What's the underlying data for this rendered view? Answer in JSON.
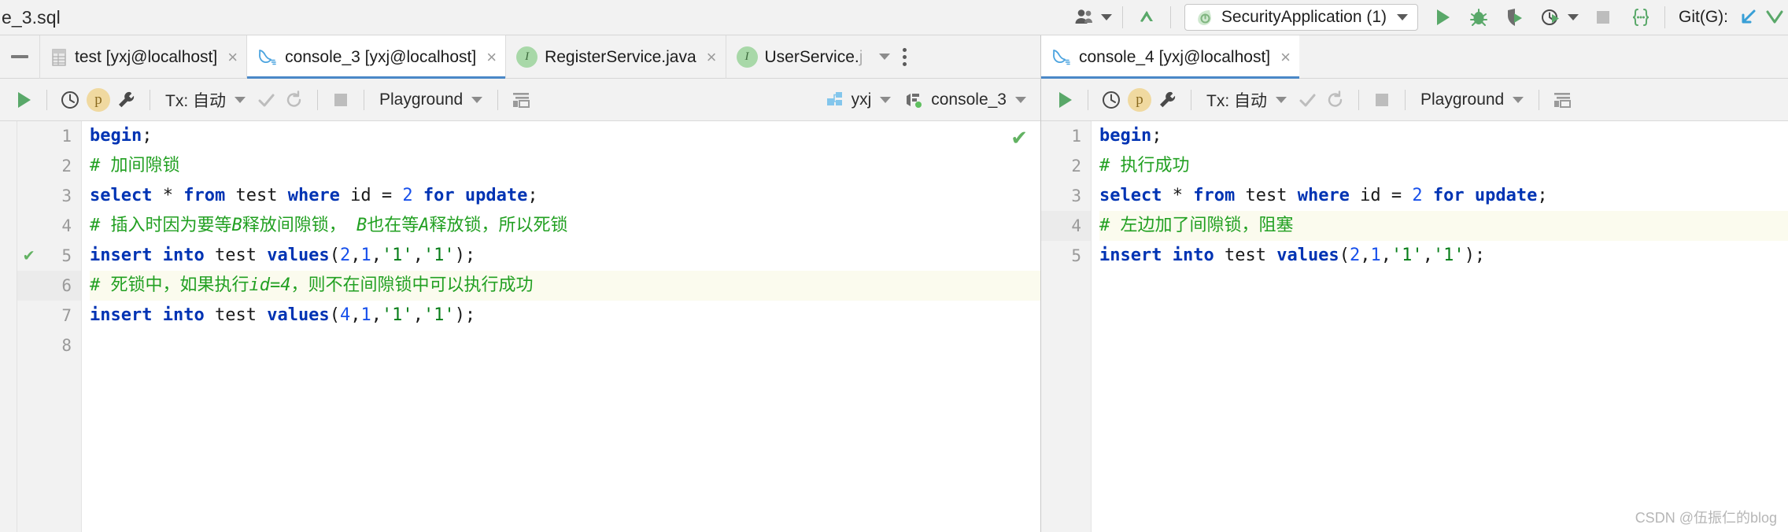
{
  "titlebar": {
    "filename": "e_3.sql",
    "user_icon": "users-icon",
    "vcs_update_icon": "vcs-update-arrow-icon",
    "run_config": {
      "icon": "spring-boot-leaf-icon",
      "label": "SecurityApplication (1)",
      "caret": "chevron-down-icon"
    },
    "actions": [
      {
        "name": "run-button",
        "icon": "play-icon"
      },
      {
        "name": "debug-button",
        "icon": "bug-icon"
      },
      {
        "name": "run-with-coverage-button",
        "icon": "coverage-shield-icon"
      },
      {
        "name": "profiler-button",
        "icon": "clock-play-icon"
      },
      {
        "name": "stop-button",
        "icon": "stop-square-icon"
      },
      {
        "name": "code-braces-button",
        "icon": "braces-icon"
      }
    ],
    "git": {
      "label": "Git(G):",
      "update_icon": "git-update-icon",
      "commit_icon": "git-commit-icon"
    }
  },
  "tabs_left": [
    {
      "name": "tab-test-db",
      "icon": "database-table-icon",
      "label": "test [yxj@localhost]",
      "selected": false,
      "close": "×"
    },
    {
      "name": "tab-console-3",
      "icon": "mysql-dolphin-icon",
      "label": "console_3 [yxj@localhost]",
      "selected": true,
      "close": "×"
    },
    {
      "name": "tab-register-service",
      "icon": "java-class-icon",
      "label": "RegisterService.java",
      "selected": false,
      "close": "×"
    },
    {
      "name": "tab-user-service",
      "icon": "java-class-icon",
      "label": "UserService.",
      "label_dim": "j",
      "selected": false,
      "close": ""
    }
  ],
  "tabs_left_overflow": {
    "chevron": "chevron-down-icon",
    "more": "more-vertical-icon"
  },
  "tabs_right": [
    {
      "name": "tab-console-4",
      "icon": "mysql-dolphin-icon",
      "label": "console_4 [yxj@localhost]",
      "selected": true,
      "close": "×"
    }
  ],
  "editor_left": {
    "toolbar": {
      "execute": "play-icon",
      "history": "clock-icon",
      "p_badge": "p",
      "settings": "wrench-icon",
      "tx_label": "Tx: 自动",
      "commit": "check-icon",
      "rollback": "rollback-icon",
      "stop": "stop-square-icon",
      "schema_label": "Playground",
      "params": "table-params-icon",
      "datasource_label": "yxj",
      "session_label": "console_3"
    },
    "gutter_checks": {
      "5": true
    },
    "active_line": 6,
    "highlight_lines": [
      6
    ],
    "pane_status_check": true,
    "lines": [
      {
        "n": 1,
        "tokens": [
          {
            "t": "kw",
            "v": "begin"
          },
          {
            "t": "op",
            "v": ";"
          }
        ]
      },
      {
        "n": 2,
        "tokens": [
          {
            "t": "cmt",
            "v": "# 加间隙锁"
          }
        ]
      },
      {
        "n": 3,
        "tokens": [
          {
            "t": "kw",
            "v": "select"
          },
          {
            "t": "op",
            "v": " "
          },
          {
            "t": "op",
            "v": "*"
          },
          {
            "t": "op",
            "v": " "
          },
          {
            "t": "kw",
            "v": "from"
          },
          {
            "t": "op",
            "v": " test "
          },
          {
            "t": "kw",
            "v": "where"
          },
          {
            "t": "op",
            "v": " id = "
          },
          {
            "t": "num",
            "v": "2"
          },
          {
            "t": "op",
            "v": " "
          },
          {
            "t": "kw",
            "v": "for"
          },
          {
            "t": "op",
            "v": " "
          },
          {
            "t": "kw",
            "v": "update"
          },
          {
            "t": "op",
            "v": ";"
          }
        ]
      },
      {
        "n": 4,
        "tokens": [
          {
            "t": "cmt",
            "v": "# 插入时因为要等"
          },
          {
            "t": "cmti",
            "v": "B"
          },
          {
            "t": "cmt",
            "v": "释放间隙锁， "
          },
          {
            "t": "cmti",
            "v": "B"
          },
          {
            "t": "cmt",
            "v": "也在等"
          },
          {
            "t": "cmti",
            "v": "A"
          },
          {
            "t": "cmt",
            "v": "释放锁，所以死锁"
          }
        ]
      },
      {
        "n": 5,
        "tokens": [
          {
            "t": "kw",
            "v": "insert"
          },
          {
            "t": "op",
            "v": " "
          },
          {
            "t": "kw",
            "v": "into"
          },
          {
            "t": "op",
            "v": " test "
          },
          {
            "t": "kw",
            "v": "values"
          },
          {
            "t": "op",
            "v": "("
          },
          {
            "t": "num",
            "v": "2"
          },
          {
            "t": "op",
            "v": ","
          },
          {
            "t": "num",
            "v": "1"
          },
          {
            "t": "op",
            "v": ","
          },
          {
            "t": "str",
            "v": "'1'"
          },
          {
            "t": "op",
            "v": ","
          },
          {
            "t": "str",
            "v": "'1'"
          },
          {
            "t": "op",
            "v": ");"
          }
        ]
      },
      {
        "n": 6,
        "tokens": [
          {
            "t": "cmt",
            "v": "# 死锁中，如果执行"
          },
          {
            "t": "cmti",
            "v": "id=4"
          },
          {
            "t": "cmt",
            "v": "，则不在间隙锁中可以执行成功"
          }
        ]
      },
      {
        "n": 7,
        "tokens": [
          {
            "t": "kw",
            "v": "insert"
          },
          {
            "t": "op",
            "v": " "
          },
          {
            "t": "kw",
            "v": "into"
          },
          {
            "t": "op",
            "v": " test "
          },
          {
            "t": "kw",
            "v": "values"
          },
          {
            "t": "op",
            "v": "("
          },
          {
            "t": "num",
            "v": "4"
          },
          {
            "t": "op",
            "v": ","
          },
          {
            "t": "num",
            "v": "1"
          },
          {
            "t": "op",
            "v": ","
          },
          {
            "t": "str",
            "v": "'1'"
          },
          {
            "t": "op",
            "v": ","
          },
          {
            "t": "str",
            "v": "'1'"
          },
          {
            "t": "op",
            "v": ");"
          }
        ]
      },
      {
        "n": 8,
        "tokens": []
      }
    ]
  },
  "editor_right": {
    "toolbar": {
      "execute": "play-icon",
      "history": "clock-icon",
      "p_badge": "p",
      "settings": "wrench-icon",
      "tx_label": "Tx: 自动",
      "commit": "check-icon",
      "rollback": "rollback-icon",
      "stop": "stop-square-icon",
      "schema_label": "Playground",
      "params": "table-params-icon"
    },
    "active_line": 4,
    "highlight_lines": [
      4
    ],
    "lines": [
      {
        "n": 1,
        "tokens": [
          {
            "t": "kw",
            "v": "begin"
          },
          {
            "t": "op",
            "v": ";"
          }
        ]
      },
      {
        "n": 2,
        "tokens": [
          {
            "t": "cmt",
            "v": "# 执行成功"
          }
        ]
      },
      {
        "n": 3,
        "tokens": [
          {
            "t": "kw",
            "v": "select"
          },
          {
            "t": "op",
            "v": " "
          },
          {
            "t": "op",
            "v": "*"
          },
          {
            "t": "op",
            "v": " "
          },
          {
            "t": "kw",
            "v": "from"
          },
          {
            "t": "op",
            "v": " test "
          },
          {
            "t": "kw",
            "v": "where"
          },
          {
            "t": "op",
            "v": " id = "
          },
          {
            "t": "num",
            "v": "2"
          },
          {
            "t": "op",
            "v": " "
          },
          {
            "t": "kw",
            "v": "for"
          },
          {
            "t": "op",
            "v": " "
          },
          {
            "t": "kw",
            "v": "update"
          },
          {
            "t": "op",
            "v": ";"
          }
        ]
      },
      {
        "n": 4,
        "tokens": [
          {
            "t": "cmt",
            "v": "# 左边加了间隙锁，阻塞"
          }
        ]
      },
      {
        "n": 5,
        "tokens": [
          {
            "t": "kw",
            "v": "insert"
          },
          {
            "t": "op",
            "v": " "
          },
          {
            "t": "kw",
            "v": "into"
          },
          {
            "t": "op",
            "v": " test "
          },
          {
            "t": "kw",
            "v": "values"
          },
          {
            "t": "op",
            "v": "("
          },
          {
            "t": "num",
            "v": "2"
          },
          {
            "t": "op",
            "v": ","
          },
          {
            "t": "num",
            "v": "1"
          },
          {
            "t": "op",
            "v": ","
          },
          {
            "t": "str",
            "v": "'1'"
          },
          {
            "t": "op",
            "v": ","
          },
          {
            "t": "str",
            "v": "'1'"
          },
          {
            "t": "op",
            "v": ");"
          }
        ]
      }
    ]
  },
  "watermark": "CSDN @伍振仁的blog",
  "colors": {
    "keyword": "#0033b3",
    "comment": "#22a022",
    "string": "#067d17",
    "number": "#1750eb",
    "accent_tab": "#4a88c7",
    "toolbar_bg": "#f2f2f2",
    "editor_bg": "#ffffff",
    "highlight_line": "#fbfbee",
    "success_green": "#62b262"
  }
}
